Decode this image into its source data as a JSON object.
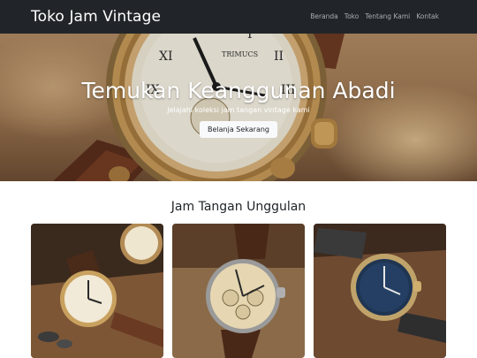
{
  "navbar": {
    "brand": "Toko Jam Vintage",
    "links": [
      "Beranda",
      "Toko",
      "Tentang Kami",
      "Kontak"
    ]
  },
  "hero": {
    "title": "Temukan Keanggunan Abadi",
    "subtitle": "Jelajahi koleksi jam tangan vintage kami",
    "button": "Belanja Sekarang",
    "watch_face_text": "TRIMUCS"
  },
  "featured": {
    "title": "Jam Tangan Unggulan",
    "products": [
      {
        "image": "vintage-gold-pocket-watch-photo"
      },
      {
        "image": "vintage-chronograph-watch-photo"
      },
      {
        "image": "vintage-blue-dial-watch-photo"
      }
    ]
  },
  "colors": {
    "navbar_bg": "#212529",
    "nav_link": "#a9aeb3",
    "button_bg": "#f8f9fa"
  }
}
